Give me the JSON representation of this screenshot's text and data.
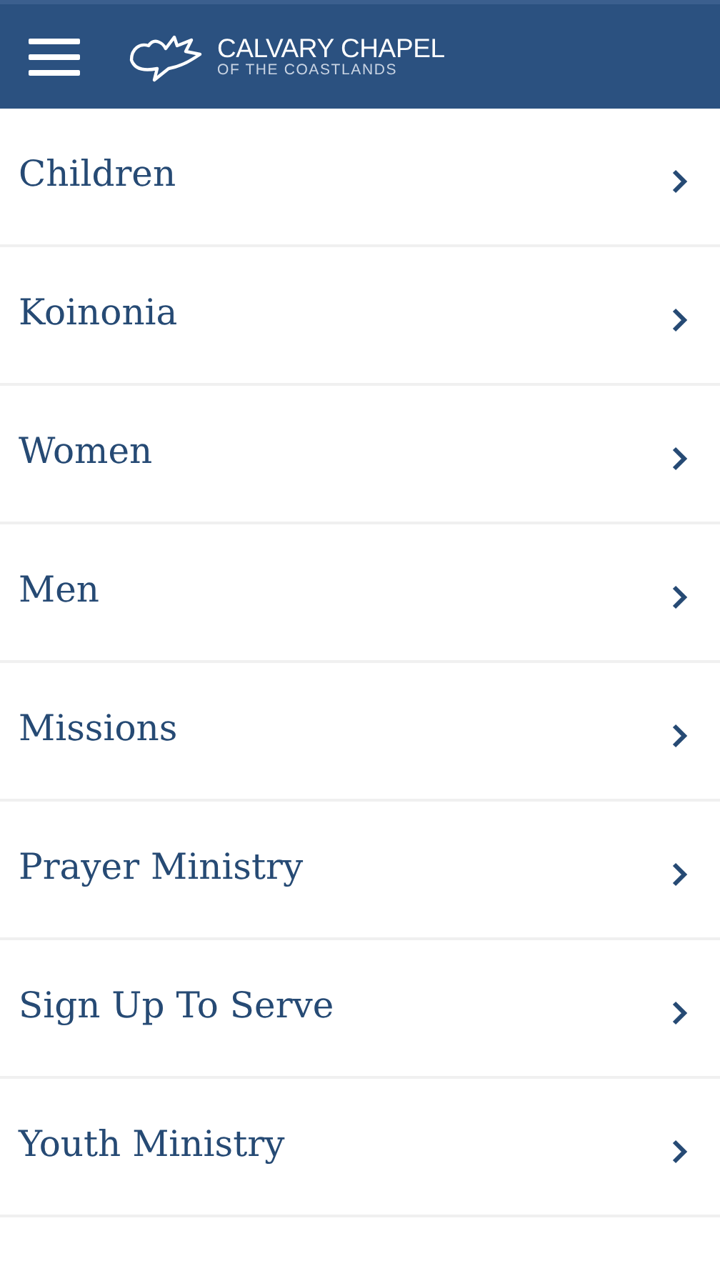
{
  "header": {
    "title": "CALVARY CHAPEL",
    "subtitle": "OF THE COASTLANDS"
  },
  "items": [
    {
      "label": "Children"
    },
    {
      "label": "Koinonia"
    },
    {
      "label": "Women"
    },
    {
      "label": "Men"
    },
    {
      "label": "Missions"
    },
    {
      "label": "Prayer Ministry"
    },
    {
      "label": "Sign Up To Serve"
    },
    {
      "label": "Youth Ministry"
    }
  ]
}
